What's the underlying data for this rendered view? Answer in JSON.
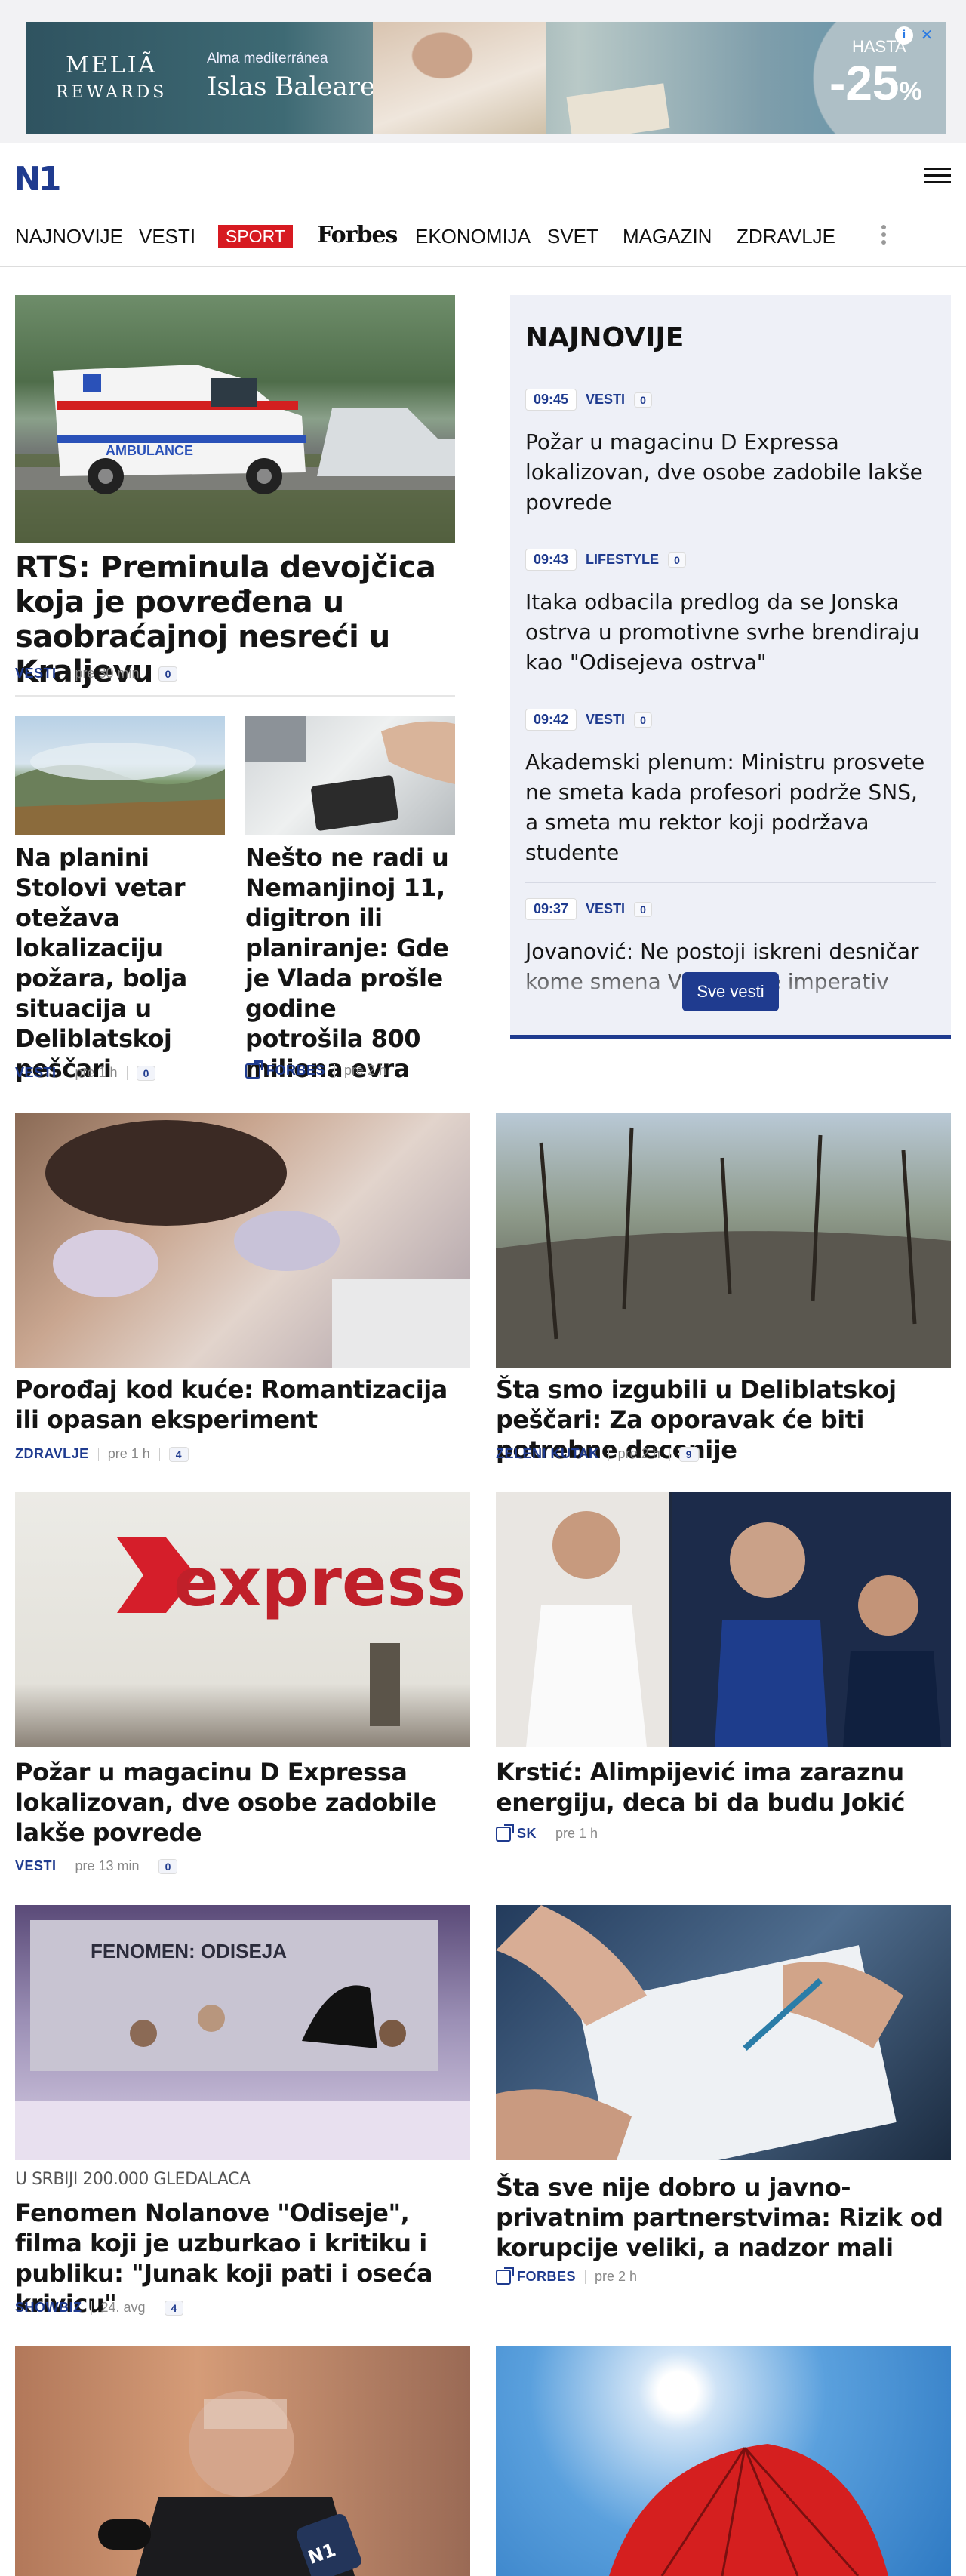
{
  "ad": {
    "brand_top": "MELIÃ",
    "brand_bottom": "REWARDS",
    "subtitle": "Alma mediterránea",
    "destination": "Islas Baleares",
    "upto": "HASTA",
    "discount": "-25",
    "percent": "%"
  },
  "header": {
    "logo": "N1"
  },
  "nav": [
    "NAJNOVIJE",
    "VESTI",
    "SPORT",
    "Forbes",
    "EKONOMIJA",
    "SVET",
    "MAGAZIN",
    "ZDRAVLJE"
  ],
  "lead": {
    "title": "RTS: Preminula devojčica koja je povređena u saobraćajnoj nesreći u Kraljevu",
    "category": "VESTI",
    "time": "pre 30 min",
    "comments": "0"
  },
  "small": [
    {
      "title": "Na planini Stolovi vetar otežava lokalizaciju požara, bolja situacija u Deliblatskoj peščari",
      "category": "VESTI",
      "time": "pre 1 h",
      "comments": "0"
    },
    {
      "title": "Nešto ne radi u Nemanjinoj 11, digitron ili planiranje: Gde je Vlada prošle godine potrošila 800 miliona evra",
      "category": "FORBES",
      "time": "pre 2 h"
    }
  ],
  "latest": {
    "heading": "NAJNOVIJE",
    "items": [
      {
        "time": "09:45",
        "category": "VESTI",
        "comments": "0",
        "title": "Požar u magacinu D Expressa lokalizovan, dve osobe zadobile lakše povrede"
      },
      {
        "time": "09:43",
        "category": "LIFESTYLE",
        "comments": "0",
        "title": "Itaka odbacila predlog da se Jonska ostrva u promotivne svrhe brendiraju kao \"Odisejeva ostrva\""
      },
      {
        "time": "09:42",
        "category": "VESTI",
        "comments": "0",
        "title": "Akademski plenum: Ministru prosvete ne smeta kada profesori podrže SNS, a smeta mu rektor koji podržava studente"
      },
      {
        "time": "09:37",
        "category": "VESTI",
        "comments": "0",
        "title": "Jovanović: Ne postoji iskreni desničar kome smena Vučića nije imperativ"
      }
    ],
    "button": "Sve vesti"
  },
  "grid": [
    {
      "title": "Porođaj kod kuće: Romantizacija ili opasan eksperiment",
      "category": "ZDRAVLJE",
      "time": "pre 1 h",
      "comments": "4"
    },
    {
      "title": "Šta smo izgubili u Deliblatskoj peščari: Za oporavak će biti potrebne decenije",
      "category": "ZELENI KUTAK",
      "time": "pre 2 h",
      "comments": "9"
    },
    {
      "title": "Požar u magacinu D Expressa lokalizovan, dve osobe zadobile lakše povrede",
      "category": "VESTI",
      "time": "pre 13 min",
      "comments": "0"
    },
    {
      "title": "Krstić: Alimpijević ima zaraznu energiju, deca bi da budu Jokić",
      "category": "SK",
      "time": "pre 1 h"
    },
    {
      "kicker": "U SRBIJI 200.000 GLEDALACA",
      "title": "Fenomen Nolanove \"Odiseje\", filma koji je uzburkao i kritiku i publiku: \"Junak koji pati i oseća krivicu\"",
      "category": "SHOWBIZ",
      "time": "24. avg",
      "comments": "4"
    },
    {
      "title": "Šta sve nije dobro u javno-privatnim partnerstvima: Rizik od korupcije veliki, a nadzor mali",
      "category": "FORBES",
      "time": "pre 2 h"
    }
  ],
  "image_labels": {
    "ambulance": "AMBULANCE",
    "express": "express",
    "odiseja": "FENOMEN: ODISEJA",
    "n1mic": "N1"
  }
}
